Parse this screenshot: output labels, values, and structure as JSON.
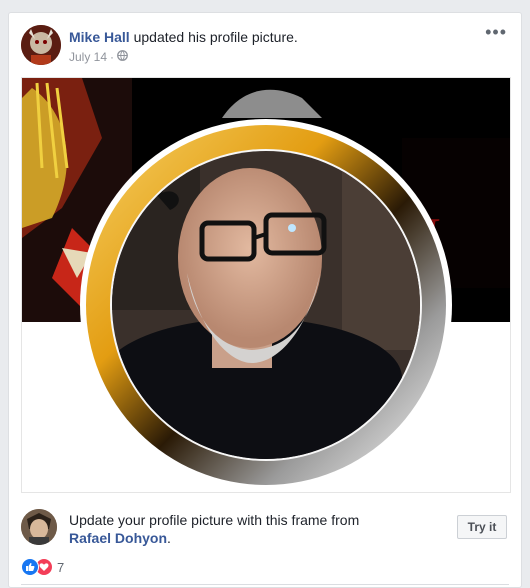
{
  "post": {
    "author": "Mike Hall",
    "action": " updated his profile picture.",
    "date": "July 14",
    "separator": "·",
    "privacy_icon": "globe-icon",
    "more_icon": "more-options-icon",
    "more_label": "•••"
  },
  "frame_promo": {
    "text": "Update your profile picture with this frame from ",
    "author": "Rafael Dohyon",
    "end": ".",
    "button_label": "Try it"
  },
  "reactions": {
    "icons": [
      "like-icon",
      "love-icon"
    ],
    "count": "7"
  },
  "colors": {
    "link": "#385898",
    "frame_gold": "#e8a317",
    "cover_bg": "#000000"
  }
}
